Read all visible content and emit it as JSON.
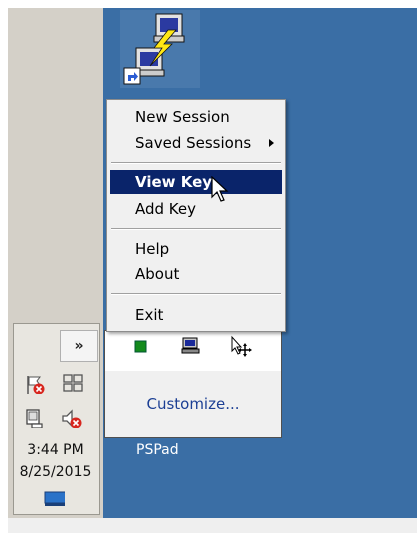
{
  "menu": {
    "items": [
      {
        "label": "New Session"
      },
      {
        "label": "Saved Sessions"
      },
      {
        "label": "View Key"
      },
      {
        "label": "Add Key"
      },
      {
        "label": "Help"
      },
      {
        "label": "About"
      },
      {
        "label": "Exit"
      }
    ]
  },
  "tray_popup": {
    "customize_label": "Customize...",
    "overflow_app_label": "PSPad"
  },
  "taskbar": {
    "chevron": "»",
    "time": "3:44 PM",
    "date": "8/25/2015"
  },
  "colors": {
    "desktop": "#3a6ea5",
    "menu_highlight": "#0a246a",
    "link": "#1c3f94"
  },
  "icons": [
    "putty-connection-icon",
    "shortcut-arrow-icon",
    "flag-error-icon",
    "windows-logo-icon",
    "network-icon",
    "speaker-muted-icon",
    "display-icon",
    "green-square-icon",
    "computer-icon",
    "move-cursor-icon",
    "arrow-cursor-icon",
    "submenu-arrow-icon"
  ]
}
